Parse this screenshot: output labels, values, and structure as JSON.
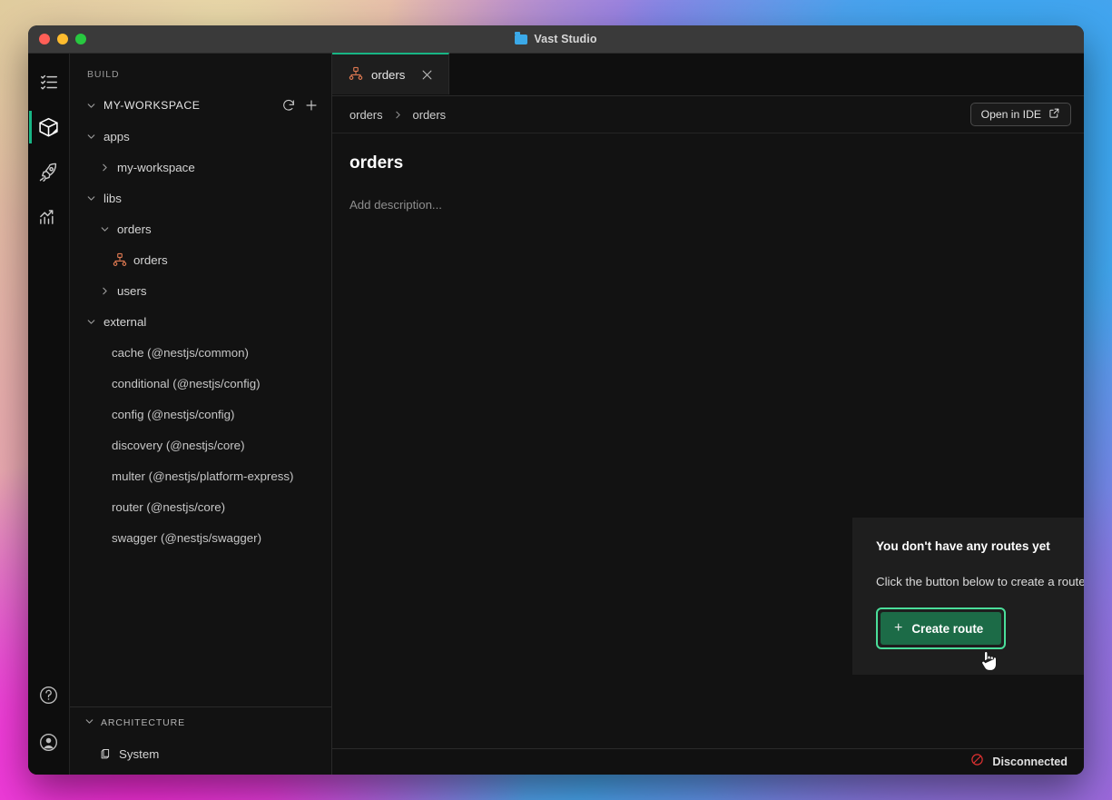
{
  "window": {
    "title": "Vast Studio",
    "title_icon": "folder-icon",
    "traffic_lights": [
      "close",
      "minimize",
      "zoom"
    ]
  },
  "rail": {
    "items": [
      {
        "icon": "checklist-icon",
        "name": "tasks",
        "active": false
      },
      {
        "icon": "package-icon",
        "name": "build",
        "active": true
      },
      {
        "icon": "rocket-icon",
        "name": "deploy",
        "active": false
      },
      {
        "icon": "chart-icon",
        "name": "insights",
        "active": false
      }
    ],
    "bottom_items": [
      {
        "icon": "help-icon",
        "name": "help"
      },
      {
        "icon": "account-icon",
        "name": "account"
      }
    ],
    "active_color": "#18b585"
  },
  "explorer": {
    "section_label": "BUILD",
    "workspace": {
      "label": "MY-WORKSPACE",
      "refresh_title": "refresh-icon",
      "add_title": "plus-icon"
    },
    "tree": [
      {
        "label": "apps",
        "indent": 0,
        "chevron": "down"
      },
      {
        "label": "my-workspace",
        "indent": 1,
        "chevron": "right"
      },
      {
        "label": "libs",
        "indent": 0,
        "chevron": "down"
      },
      {
        "label": "orders",
        "indent": 1,
        "chevron": "down"
      },
      {
        "label": "orders",
        "indent": 2,
        "chevron": "none",
        "icon": "sitemap-icon"
      },
      {
        "label": "users",
        "indent": 1,
        "chevron": "right"
      },
      {
        "label": "external",
        "indent": 0,
        "chevron": "down"
      }
    ],
    "external": [
      "cache (@nestjs/common)",
      "conditional (@nestjs/config)",
      "config (@nestjs/config)",
      "discovery (@nestjs/core)",
      "multer (@nestjs/platform-express)",
      "router (@nestjs/core)",
      "swagger (@nestjs/swagger)"
    ],
    "architecture": {
      "label": "ARCHITECTURE",
      "items": [
        {
          "label": "System",
          "icon": "cube-icon"
        }
      ]
    }
  },
  "tabs": [
    {
      "label": "orders",
      "icon": "sitemap-icon",
      "active": true,
      "close": "close-icon"
    }
  ],
  "breadcrumb": {
    "items": [
      "orders",
      "orders"
    ],
    "separator": "chevron-right-icon"
  },
  "toolbar": {
    "open_in_ide_label": "Open in IDE",
    "open_in_ide_icon": "external-link-icon"
  },
  "page": {
    "title": "orders",
    "description_placeholder": "Add description..."
  },
  "empty_state": {
    "title": "You don't have any routes yet",
    "subtitle": "Click the button below to create a route.",
    "button_label": "Create route",
    "button_icon": "plus-icon",
    "button_color": "#1c6b47",
    "focus_ring_color": "#4ade9a"
  },
  "statusbar": {
    "connection_label": "Disconnected",
    "connection_icon": "ban-icon",
    "connection_color": "#e03131"
  }
}
